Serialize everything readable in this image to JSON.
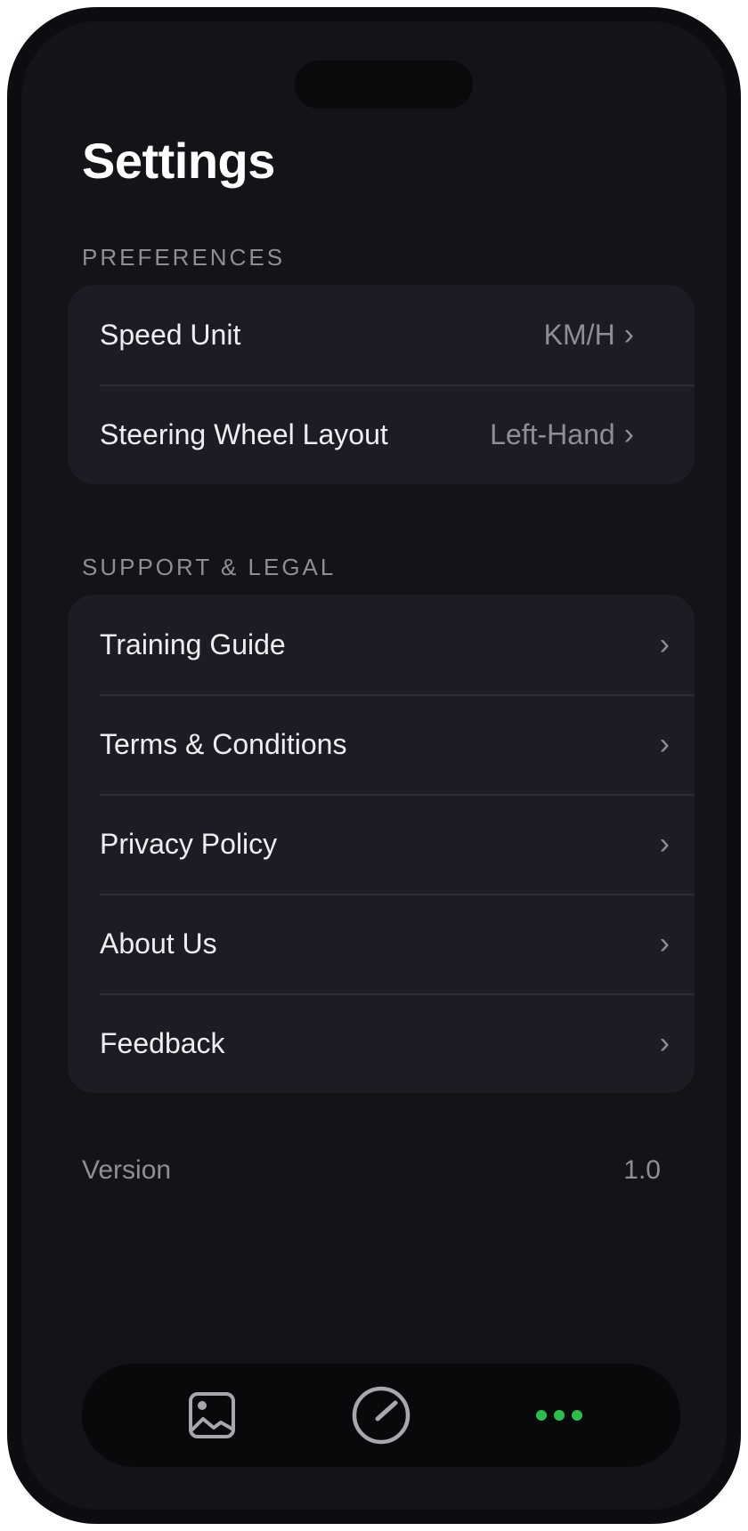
{
  "page_title": "Settings",
  "sections": {
    "preferences": {
      "header": "PREFERENCES",
      "items": [
        {
          "label": "Speed Unit",
          "value": "KM/H"
        },
        {
          "label": "Steering Wheel Layout",
          "value": "Left-Hand"
        }
      ]
    },
    "support": {
      "header": "SUPPORT & LEGAL",
      "items": [
        {
          "label": "Training Guide"
        },
        {
          "label": "Terms & Conditions"
        },
        {
          "label": "Privacy Policy"
        },
        {
          "label": "About Us"
        },
        {
          "label": "Feedback"
        }
      ]
    }
  },
  "version": {
    "label": "Version",
    "value": "1.0"
  },
  "chevron": "›",
  "tabbar": {
    "tabs": [
      {
        "icon": "gallery-icon",
        "active": false
      },
      {
        "icon": "speedometer-icon",
        "active": false
      },
      {
        "icon": "more-dots-icon",
        "active": true
      }
    ]
  },
  "colors": {
    "background": "#131418",
    "card": "#1c1d24",
    "accent": "#2dbd4e",
    "secondary_text": "#8e8e96"
  }
}
